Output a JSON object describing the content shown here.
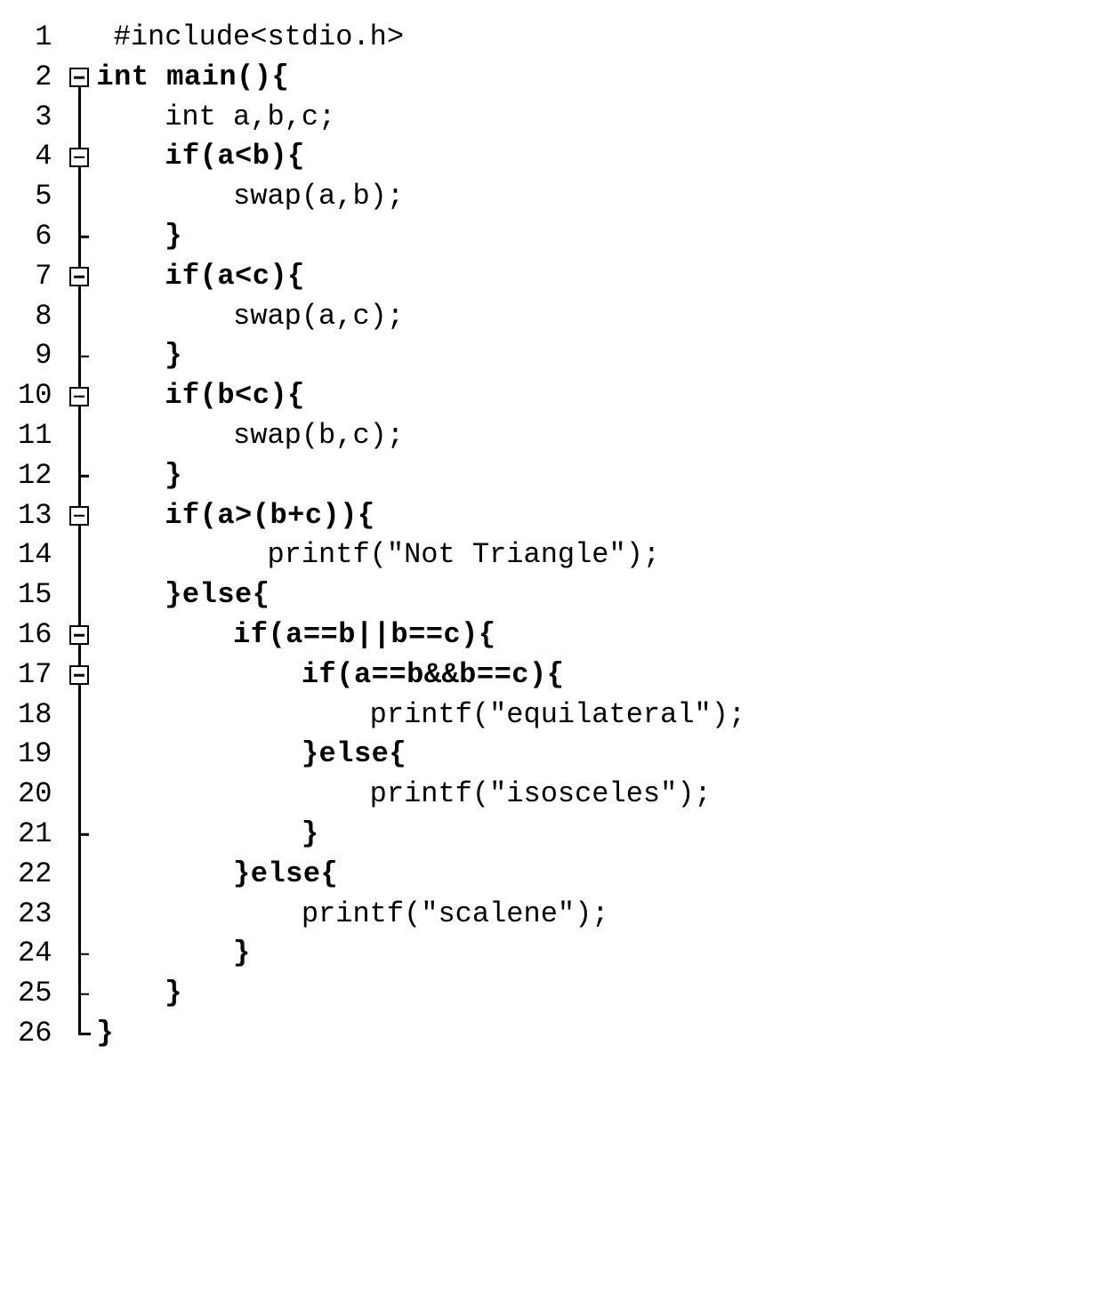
{
  "lines": [
    {
      "num": "1",
      "gutter": {
        "type": "blank"
      },
      "segs": [
        {
          "t": " #include<stdio.h>",
          "b": false
        }
      ]
    },
    {
      "num": "2",
      "gutter": {
        "type": "fold",
        "bottom": true
      },
      "segs": [
        {
          "t": "int main(){",
          "b": true
        }
      ]
    },
    {
      "num": "3",
      "gutter": {
        "type": "line"
      },
      "segs": [
        {
          "t": "    int a,b,c;",
          "b": false
        }
      ]
    },
    {
      "num": "4",
      "gutter": {
        "type": "fold",
        "top": true,
        "bottom": true
      },
      "segs": [
        {
          "t": "    ",
          "b": false
        },
        {
          "t": "if(a<b){",
          "b": true
        }
      ]
    },
    {
      "num": "5",
      "gutter": {
        "type": "line"
      },
      "segs": [
        {
          "t": "        swap(a,b);",
          "b": false
        }
      ]
    },
    {
      "num": "6",
      "gutter": {
        "type": "tick"
      },
      "segs": [
        {
          "t": "    ",
          "b": false
        },
        {
          "t": "}",
          "b": true
        }
      ]
    },
    {
      "num": "7",
      "gutter": {
        "type": "fold",
        "top": true,
        "bottom": true
      },
      "segs": [
        {
          "t": "    ",
          "b": false
        },
        {
          "t": "if(a<c){",
          "b": true
        }
      ]
    },
    {
      "num": "8",
      "gutter": {
        "type": "line"
      },
      "segs": [
        {
          "t": "        swap(a,c);",
          "b": false
        }
      ]
    },
    {
      "num": "9",
      "gutter": {
        "type": "tick"
      },
      "segs": [
        {
          "t": "    ",
          "b": false
        },
        {
          "t": "}",
          "b": true
        }
      ]
    },
    {
      "num": "10",
      "gutter": {
        "type": "fold",
        "top": true,
        "bottom": true
      },
      "segs": [
        {
          "t": "    ",
          "b": false
        },
        {
          "t": "if(b<c){",
          "b": true
        }
      ]
    },
    {
      "num": "11",
      "gutter": {
        "type": "line"
      },
      "segs": [
        {
          "t": "        swap(b,c);",
          "b": false
        }
      ]
    },
    {
      "num": "12",
      "gutter": {
        "type": "tick"
      },
      "segs": [
        {
          "t": "    ",
          "b": false
        },
        {
          "t": "}",
          "b": true
        }
      ]
    },
    {
      "num": "13",
      "gutter": {
        "type": "fold",
        "top": true,
        "bottom": true
      },
      "segs": [
        {
          "t": "    ",
          "b": false
        },
        {
          "t": "if(a>(b+c)){",
          "b": true
        }
      ]
    },
    {
      "num": "14",
      "gutter": {
        "type": "line"
      },
      "segs": [
        {
          "t": "          printf(\"Not Triangle\");",
          "b": false
        }
      ]
    },
    {
      "num": "15",
      "gutter": {
        "type": "line"
      },
      "segs": [
        {
          "t": "    ",
          "b": false
        },
        {
          "t": "}else{",
          "b": true
        }
      ]
    },
    {
      "num": "16",
      "gutter": {
        "type": "fold",
        "top": true,
        "bottom": true
      },
      "segs": [
        {
          "t": "        ",
          "b": false
        },
        {
          "t": "if(a==b||b==c){",
          "b": true
        }
      ]
    },
    {
      "num": "17",
      "gutter": {
        "type": "fold",
        "top": true,
        "bottom": true
      },
      "segs": [
        {
          "t": "            ",
          "b": false
        },
        {
          "t": "if(a==b&&b==c){",
          "b": true
        }
      ]
    },
    {
      "num": "18",
      "gutter": {
        "type": "line"
      },
      "segs": [
        {
          "t": "                printf(\"equilateral\");",
          "b": false
        }
      ]
    },
    {
      "num": "19",
      "gutter": {
        "type": "line"
      },
      "segs": [
        {
          "t": "            ",
          "b": false
        },
        {
          "t": "}else{",
          "b": true
        }
      ]
    },
    {
      "num": "20",
      "gutter": {
        "type": "line"
      },
      "segs": [
        {
          "t": "                printf(\"isosceles\");",
          "b": false
        }
      ]
    },
    {
      "num": "21",
      "gutter": {
        "type": "tick"
      },
      "segs": [
        {
          "t": "            ",
          "b": false
        },
        {
          "t": "}",
          "b": true
        }
      ]
    },
    {
      "num": "22",
      "gutter": {
        "type": "line"
      },
      "segs": [
        {
          "t": "        ",
          "b": false
        },
        {
          "t": "}else{",
          "b": true
        }
      ]
    },
    {
      "num": "23",
      "gutter": {
        "type": "line"
      },
      "segs": [
        {
          "t": "            printf(\"scalene\");",
          "b": false
        }
      ]
    },
    {
      "num": "24",
      "gutter": {
        "type": "tick"
      },
      "segs": [
        {
          "t": "        ",
          "b": false
        },
        {
          "t": "}",
          "b": true
        }
      ]
    },
    {
      "num": "25",
      "gutter": {
        "type": "tick"
      },
      "segs": [
        {
          "t": "    ",
          "b": false
        },
        {
          "t": "}",
          "b": true
        }
      ]
    },
    {
      "num": "26",
      "gutter": {
        "type": "corner"
      },
      "segs": [
        {
          "t": "}",
          "b": true
        }
      ]
    }
  ]
}
